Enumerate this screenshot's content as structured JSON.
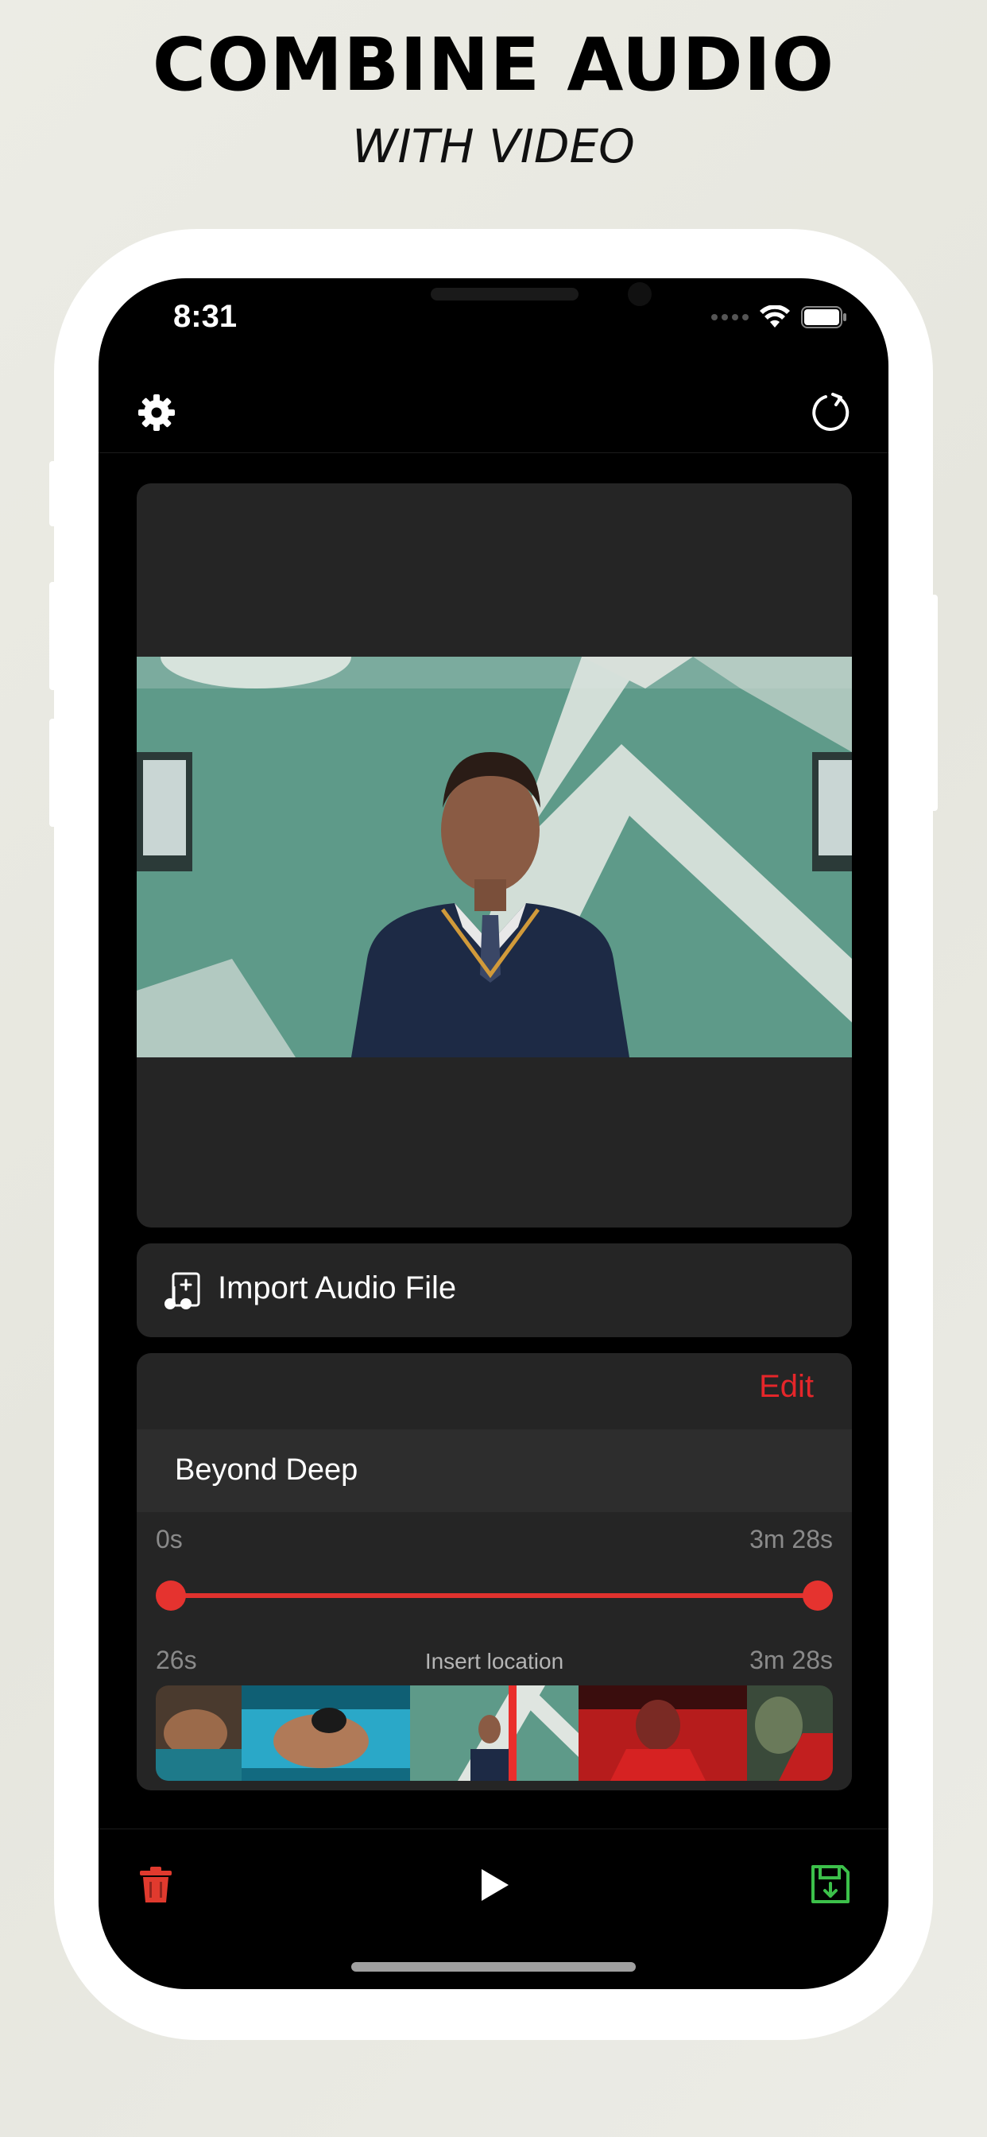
{
  "promo": {
    "headline": "COMBINE AUDIO",
    "subheadline": "WITH VIDEO"
  },
  "status_bar": {
    "time": "8:31"
  },
  "nav": {
    "settings_icon": "gear-icon",
    "reset_icon": "refresh-icon"
  },
  "import": {
    "label": "Import Audio File",
    "icon": "music-add-icon"
  },
  "audio_panel": {
    "edit_label": "Edit",
    "track_name": "Beyond Deep",
    "range_start": "0s",
    "range_end": "3m 28s",
    "insert_start": "26s",
    "insert_label": "Insert location",
    "insert_end": "3m 28s"
  },
  "toolbar": {
    "trash_icon": "trash-icon",
    "play_icon": "play-icon",
    "save_icon": "save-icon"
  },
  "colors": {
    "accent_red": "#e5262a",
    "save_green": "#3cc04a",
    "panel_bg": "#252525"
  }
}
